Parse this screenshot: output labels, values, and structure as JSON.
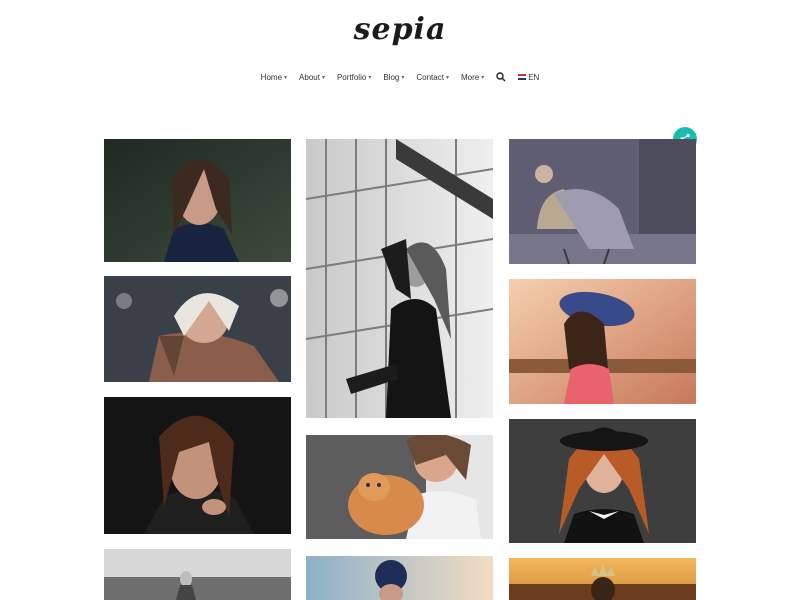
{
  "brand": {
    "logo_text": "sepia"
  },
  "nav": {
    "items": [
      {
        "label": "Home"
      },
      {
        "label": "About"
      },
      {
        "label": "Portfolio"
      },
      {
        "label": "Blog"
      },
      {
        "label": "Contact"
      },
      {
        "label": "More"
      }
    ],
    "search_icon": "search-icon",
    "language": "EN"
  },
  "share": {
    "icon": "share-icon",
    "color": "#1bbcb6"
  },
  "gallery": {
    "photos": [
      {
        "subject": "wet-haired woman in dark shirt"
      },
      {
        "subject": "tattooed blonde woman"
      },
      {
        "subject": "woman with hand on face, dark background"
      },
      {
        "subject": "person in field, black and white"
      },
      {
        "subject": "black and white woman by railing"
      },
      {
        "subject": "woman hugging ginger cat"
      },
      {
        "subject": "woman in knit beanie"
      },
      {
        "subject": "woman on vintage chair"
      },
      {
        "subject": "woman in purple sun hat"
      },
      {
        "subject": "redhead in black hat"
      },
      {
        "subject": "woman with crown at sunset"
      }
    ]
  }
}
